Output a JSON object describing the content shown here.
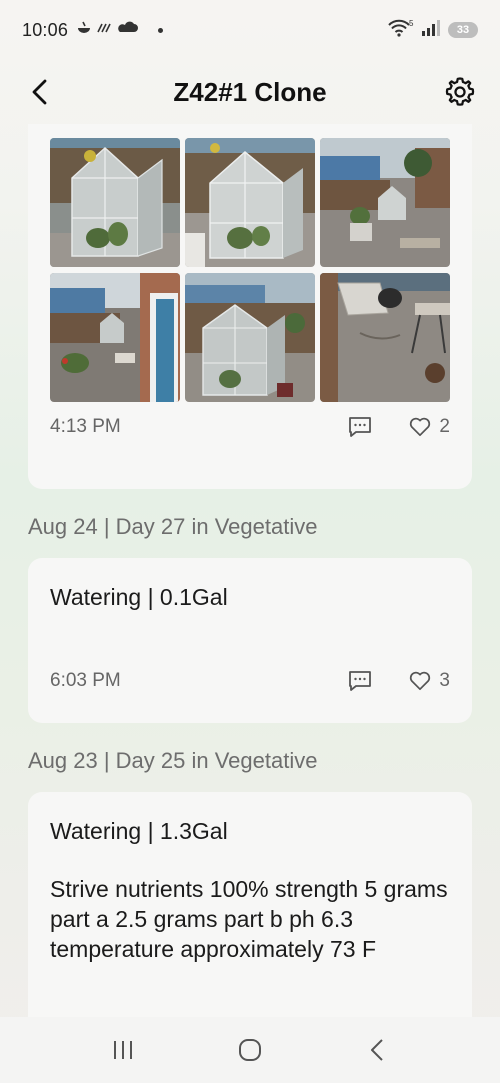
{
  "status_bar": {
    "time": "10:06",
    "battery": "33",
    "wifi_label": "5"
  },
  "header": {
    "title": "Z42#1 Clone"
  },
  "posts": [
    {
      "time": "4:13 PM",
      "likes": "2",
      "photos": [
        "greenhouse-photo-1",
        "greenhouse-photo-2",
        "backyard-photo-3",
        "patio-photo-4",
        "greenhouse-photo-5",
        "yard-photo-6"
      ]
    },
    {
      "date": "Aug 24 | Day 27 in Vegetative",
      "title": "Watering | 0.1Gal",
      "time": "6:03 PM",
      "likes": "3"
    },
    {
      "date": "Aug 23 | Day 25 in Vegetative",
      "title": "Watering | 1.3Gal",
      "body": "Strive nutrients 100% strength 5 grams part a 2.5 grams part b ph 6.3 temperature approximately 73 F"
    }
  ],
  "colors": {
    "card_bg": "#f7f7f6",
    "muted_text": "#666666",
    "accent_green": "#e6f0e6"
  },
  "icons": {
    "back": "chevron-left-icon",
    "settings": "gear-icon",
    "comment": "comment-icon",
    "like": "heart-icon"
  }
}
